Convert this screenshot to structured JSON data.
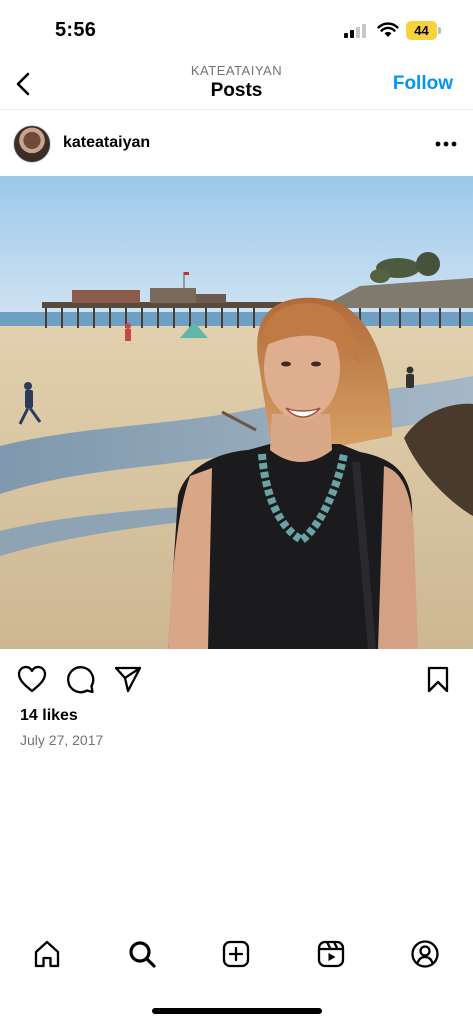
{
  "status_bar": {
    "time": "5:56",
    "battery": "44",
    "battery_color": "#f7d23b"
  },
  "header": {
    "username_caps": "KATEATAIYAN",
    "title": "Posts",
    "follow_label": "Follow",
    "follow_color": "#0095f6"
  },
  "post": {
    "author": "kateataiyan",
    "photo_icon": "beach-pier-photo",
    "likes": "14 likes",
    "date": "July 27, 2017"
  },
  "icons": {
    "back": "chevron-left-icon",
    "more": "more-horizontal-icon",
    "like": "heart-icon",
    "comment": "comment-icon",
    "share": "send-icon",
    "save": "bookmark-icon"
  },
  "nav": {
    "items": [
      "home-icon",
      "search-icon",
      "create-icon",
      "reels-icon",
      "profile-icon"
    ]
  }
}
